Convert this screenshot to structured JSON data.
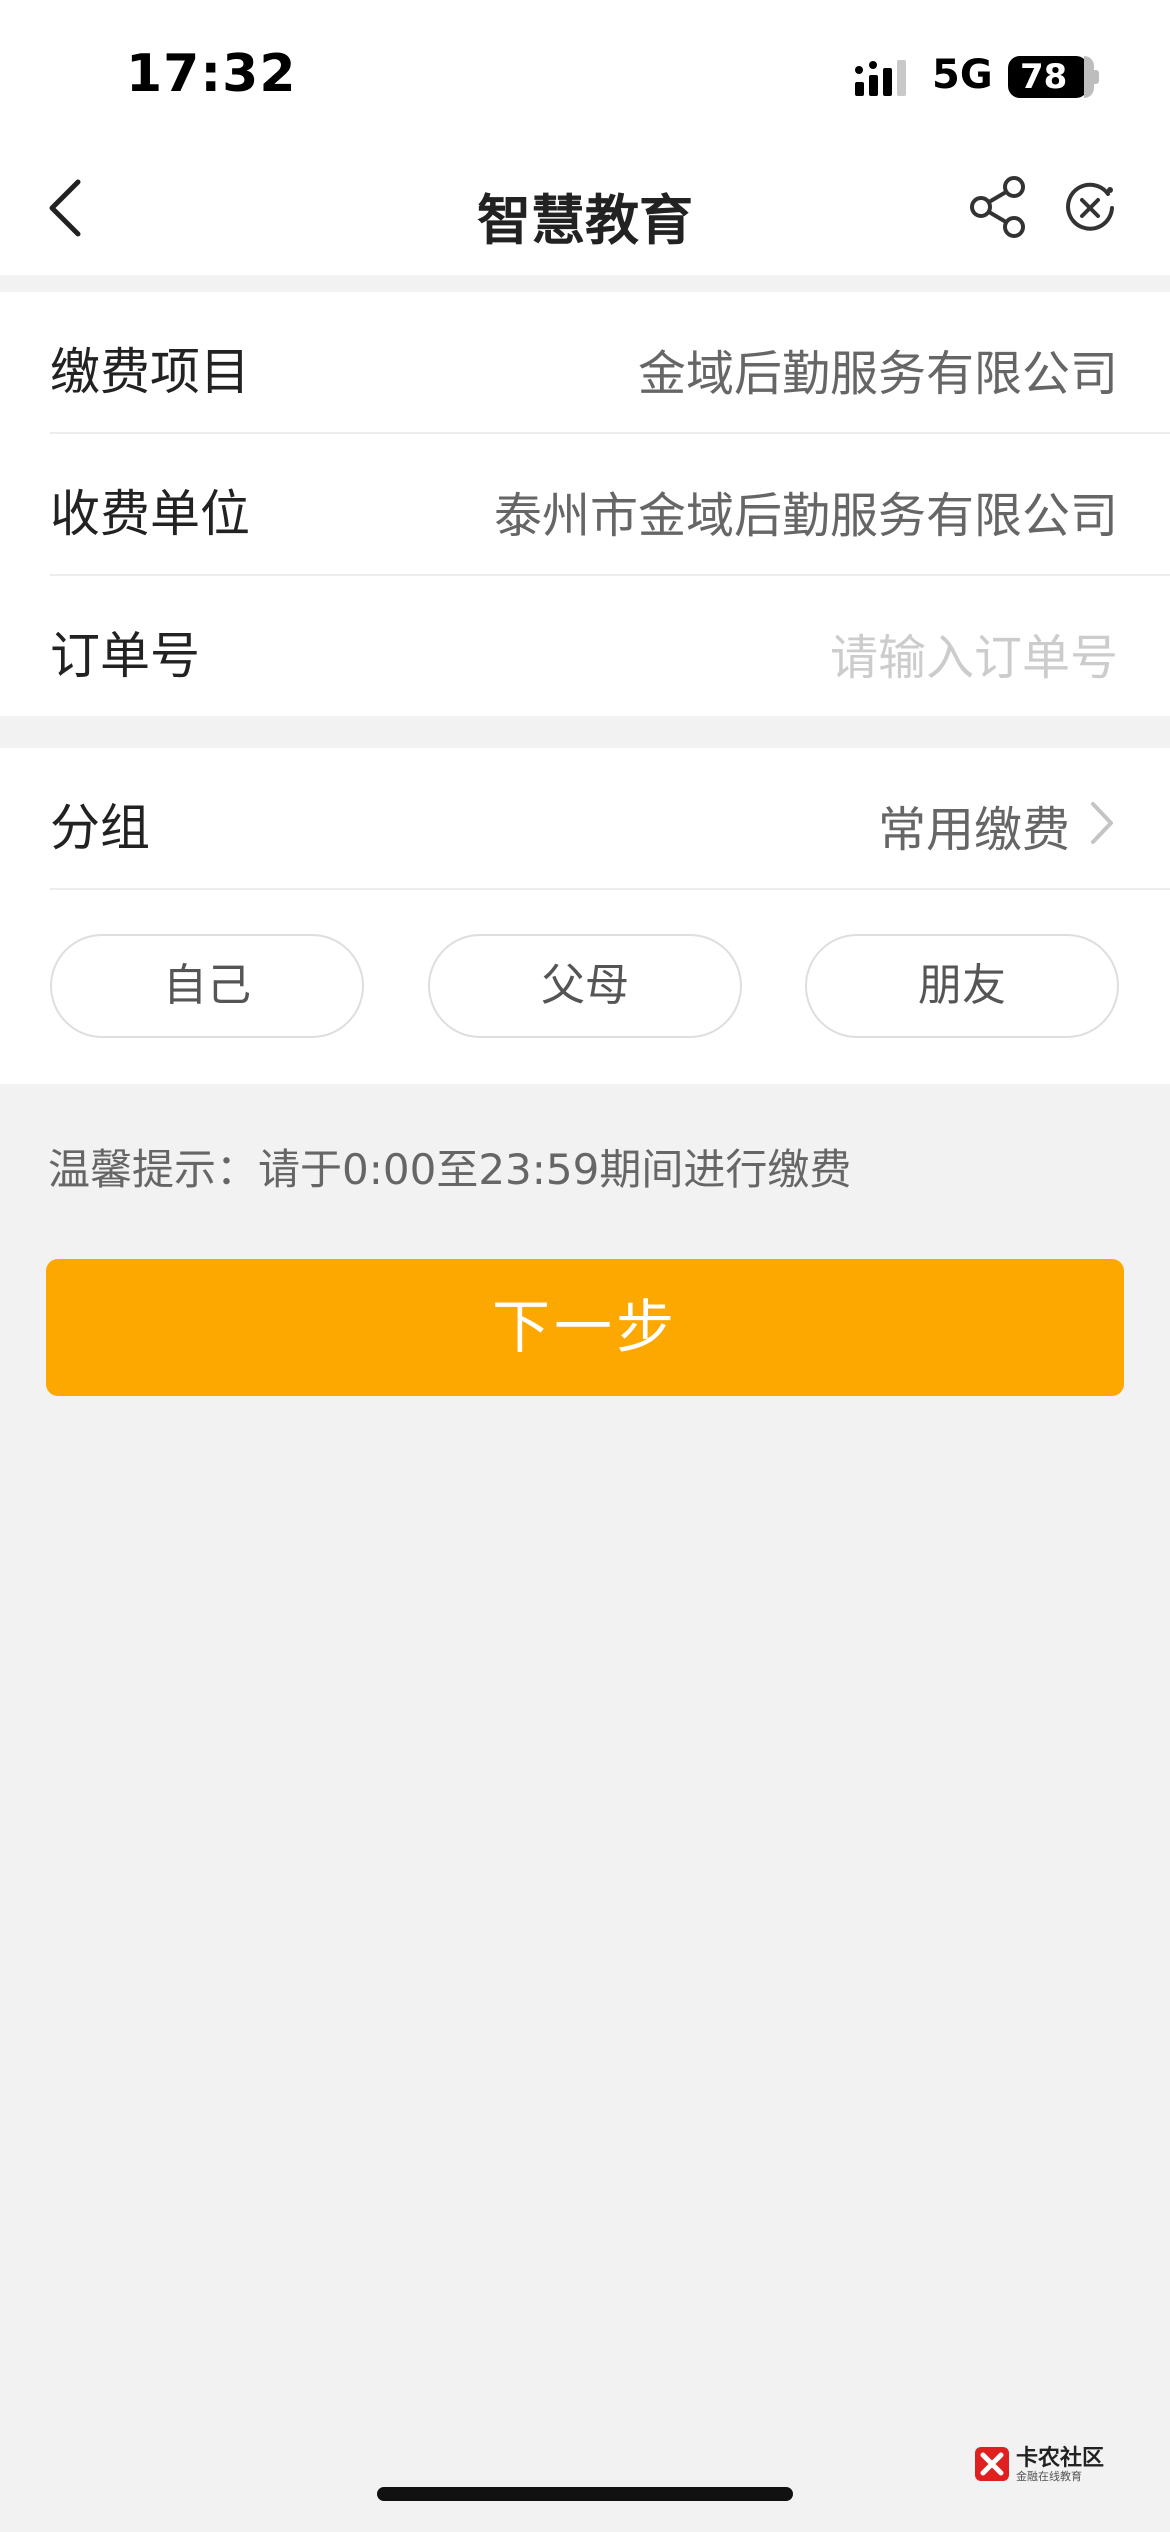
{
  "status_bar": {
    "time": "17:32",
    "network": "5G",
    "battery": "78",
    "icons": [
      "signal-icon",
      "battery-icon"
    ]
  },
  "nav": {
    "title": "智慧教育",
    "icons": [
      "back-icon",
      "share-icon",
      "close-icon"
    ]
  },
  "form": {
    "rows": [
      {
        "label": "缴费项目",
        "value": "金域后勤服务有限公司"
      },
      {
        "label": "收费单位",
        "value": "泰州市金域后勤服务有限公司"
      },
      {
        "label": "订单号",
        "placeholder": "请输入订单号"
      }
    ]
  },
  "group": {
    "label": "分组",
    "value": "常用缴费",
    "chips": [
      "自己",
      "父母",
      "朋友"
    ]
  },
  "tip": "温馨提示：请于0:00至23:59期间进行缴费",
  "next_button": "下一步",
  "watermark": {
    "title": "卡农社区",
    "subtitle": "金融在线教育"
  },
  "colors": {
    "accent": "#fca800",
    "background": "#f2f2f2",
    "card": "#ffffff",
    "placeholder": "#cccccc",
    "value_text": "#666666"
  }
}
